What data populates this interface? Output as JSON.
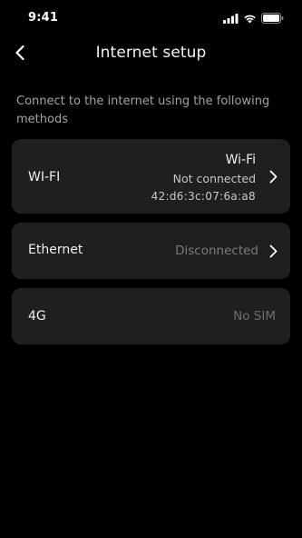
{
  "status_bar": {
    "time": "9:41",
    "icons": [
      "signal-icon",
      "wifi-icon",
      "battery-icon"
    ]
  },
  "header": {
    "title": "Internet setup",
    "back_icon": "chevron-left-icon"
  },
  "description": "Connect to the internet using the following methods",
  "methods": {
    "wifi": {
      "label": "WI-FI",
      "network_name": "Wi-Fi",
      "status": "Not connected",
      "mac_address": "42:d6:3c:07:6a:a8"
    },
    "ethernet": {
      "label": "Ethernet",
      "status": "Disconnected"
    },
    "fourg": {
      "label": "4G",
      "status": "No SIM"
    }
  },
  "colors": {
    "background": "#000000",
    "card": "#1f1f1f",
    "primary_text": "#f0f0f0",
    "secondary_text": "#a3a3a3",
    "muted_text": "#7a7a7a"
  }
}
